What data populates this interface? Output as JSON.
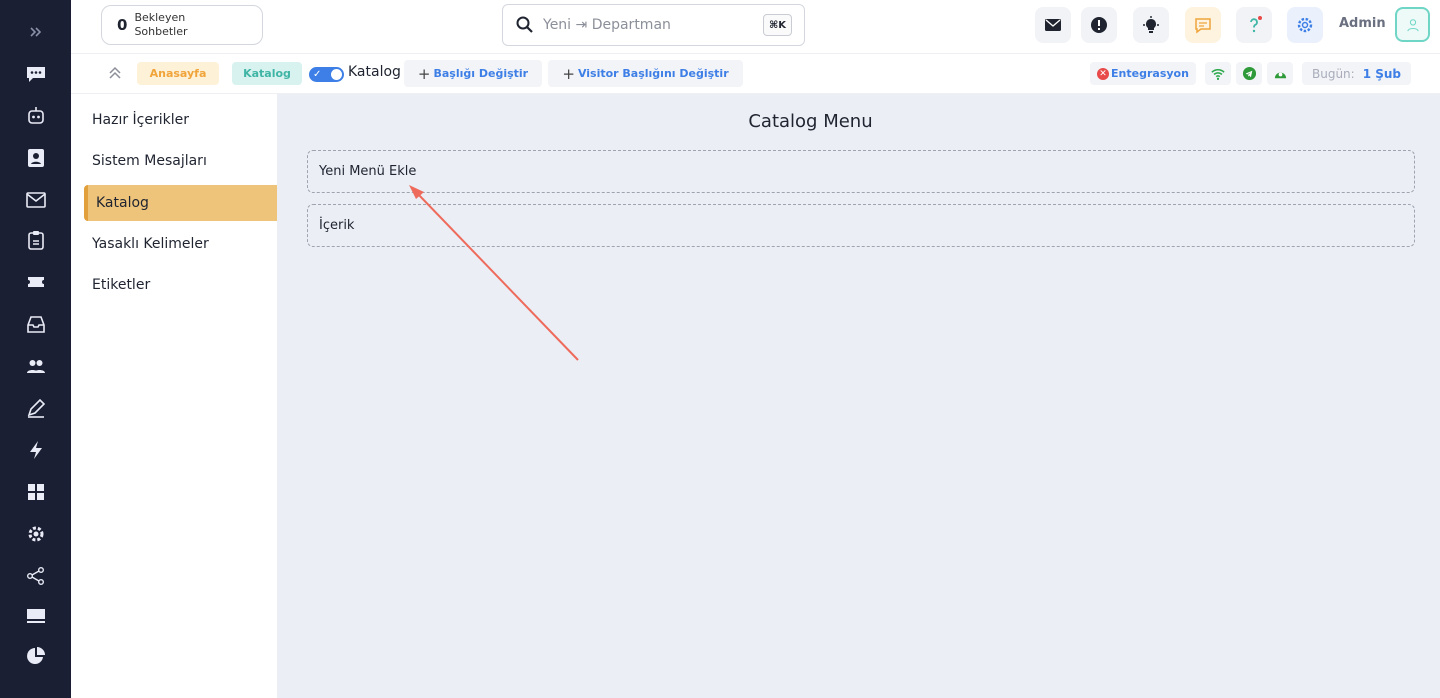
{
  "rail": {
    "items": [
      {
        "icon": "chat-icon"
      },
      {
        "icon": "robot-icon"
      },
      {
        "icon": "contact-card-icon"
      },
      {
        "icon": "mail-icon"
      },
      {
        "icon": "clipboard-icon"
      },
      {
        "icon": "ticket-icon"
      },
      {
        "icon": "inbox-icon"
      },
      {
        "icon": "users-icon"
      },
      {
        "icon": "pen-icon"
      },
      {
        "icon": "bolt-icon"
      },
      {
        "icon": "grid-icon"
      },
      {
        "icon": "settings-icon"
      },
      {
        "icon": "share-icon"
      },
      {
        "icon": "monitor-icon"
      },
      {
        "icon": "pie-chart-icon"
      }
    ]
  },
  "topbar": {
    "waiting_count": "0",
    "waiting_label": "Bekleyen Sohbetler",
    "search_placeholder": "Yeni ⇥ Departman",
    "search_shortcut": "⌘K",
    "user_name": "Admin"
  },
  "subbar": {
    "home_label": "Anasayfa",
    "catalog_pill": "Katalog",
    "toggle_label": "Katalog",
    "change_title": "Başlığı Değiştir",
    "change_visitor_title": "Visitor Başlığını Değiştir",
    "integration_label": "Entegrasyon",
    "today_label": "Bugün:",
    "today_value": "1 Şub"
  },
  "leftnav": {
    "items": [
      {
        "label": "Hazır İçerikler",
        "active": false
      },
      {
        "label": "Sistem Mesajları",
        "active": false
      },
      {
        "label": "Katalog",
        "active": true
      },
      {
        "label": "Yasaklı Kelimeler",
        "active": false
      },
      {
        "label": "Etiketler",
        "active": false
      }
    ]
  },
  "main": {
    "title": "Catalog Menu",
    "add_menu_label": "Yeni Menü Ekle",
    "content_label": "İçerik"
  },
  "colors": {
    "rail_bg": "#1b1f33",
    "accent_blue": "#3d7fe6",
    "active_nav": "#eec47b",
    "annotation_arrow": "#ee6b5c"
  }
}
